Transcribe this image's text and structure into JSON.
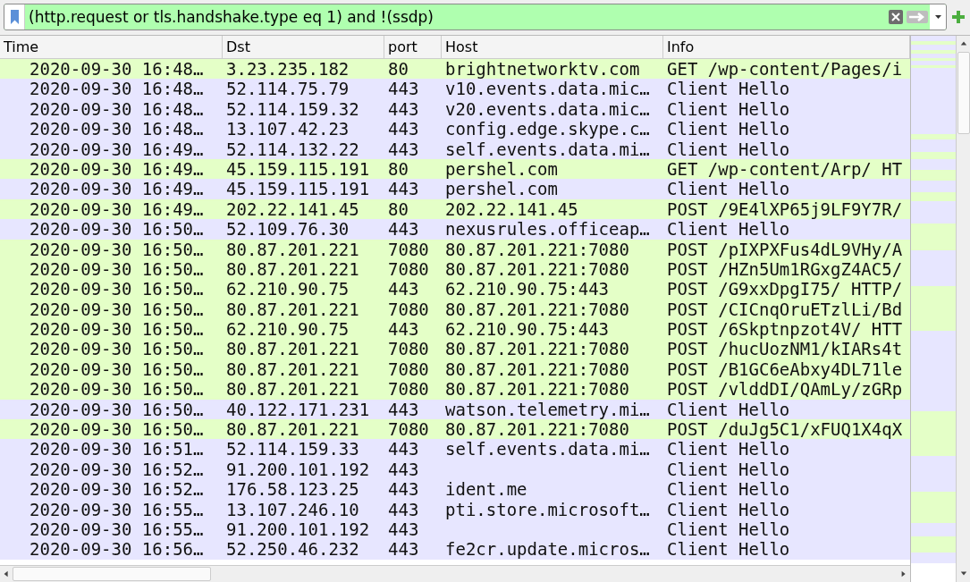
{
  "filter_bar": {
    "value": "(http.request or tls.handshake.type eq 1) and !(ssdp)",
    "valid": true
  },
  "table": {
    "columns": [
      "Time",
      "Dst",
      "port",
      "Host",
      "Info"
    ],
    "rows": [
      {
        "time": "2020-09-30 16:48…",
        "dst": "3.23.235.182",
        "port": "80",
        "host": "brightnetworktv.com",
        "info": "GET /wp-content/Pages/i",
        "color": "#e4ffc7"
      },
      {
        "time": "2020-09-30 16:48…",
        "dst": "52.114.75.79",
        "port": "443",
        "host": "v10.events.data.mic…",
        "info": "Client Hello",
        "color": "#e7e6ff"
      },
      {
        "time": "2020-09-30 16:48…",
        "dst": "52.114.159.32",
        "port": "443",
        "host": "v20.events.data.mic…",
        "info": "Client Hello",
        "color": "#e7e6ff"
      },
      {
        "time": "2020-09-30 16:48…",
        "dst": "13.107.42.23",
        "port": "443",
        "host": "config.edge.skype.c…",
        "info": "Client Hello",
        "color": "#e7e6ff"
      },
      {
        "time": "2020-09-30 16:49…",
        "dst": "52.114.132.22",
        "port": "443",
        "host": "self.events.data.mi…",
        "info": "Client Hello",
        "color": "#e7e6ff"
      },
      {
        "time": "2020-09-30 16:49…",
        "dst": "45.159.115.191",
        "port": "80",
        "host": "pershel.com",
        "info": "GET /wp-content/Arp/ HT",
        "color": "#e4ffc7"
      },
      {
        "time": "2020-09-30 16:49…",
        "dst": "45.159.115.191",
        "port": "443",
        "host": "pershel.com",
        "info": "Client Hello",
        "color": "#e7e6ff"
      },
      {
        "time": "2020-09-30 16:49…",
        "dst": "202.22.141.45",
        "port": "80",
        "host": "202.22.141.45",
        "info": "POST /9E4lXP65j9LF9Y7R/",
        "color": "#e4ffc7"
      },
      {
        "time": "2020-09-30 16:50…",
        "dst": "52.109.76.30",
        "port": "443",
        "host": "nexusrules.officeap…",
        "info": "Client Hello",
        "color": "#e7e6ff"
      },
      {
        "time": "2020-09-30 16:50…",
        "dst": "80.87.201.221",
        "port": "7080",
        "host": "80.87.201.221:7080",
        "info": "POST /pIXPXFus4dL9VHy/A",
        "color": "#e4ffc7"
      },
      {
        "time": "2020-09-30 16:50…",
        "dst": "80.87.201.221",
        "port": "7080",
        "host": "80.87.201.221:7080",
        "info": "POST /HZn5Um1RGxgZ4AC5/",
        "color": "#e4ffc7"
      },
      {
        "time": "2020-09-30 16:50…",
        "dst": "62.210.90.75",
        "port": "443",
        "host": "62.210.90.75:443",
        "info": "POST /G9xxDpgI75/ HTTP/",
        "color": "#e4ffc7"
      },
      {
        "time": "2020-09-30 16:50…",
        "dst": "80.87.201.221",
        "port": "7080",
        "host": "80.87.201.221:7080",
        "info": "POST /CICnqOruETzlLi/Bd",
        "color": "#e4ffc7"
      },
      {
        "time": "2020-09-30 16:50…",
        "dst": "62.210.90.75",
        "port": "443",
        "host": "62.210.90.75:443",
        "info": "POST /6Skptnpzot4V/ HTT",
        "color": "#e4ffc7"
      },
      {
        "time": "2020-09-30 16:50…",
        "dst": "80.87.201.221",
        "port": "7080",
        "host": "80.87.201.221:7080",
        "info": "POST /hucUozNM1/kIARs4t",
        "color": "#e4ffc7"
      },
      {
        "time": "2020-09-30 16:50…",
        "dst": "80.87.201.221",
        "port": "7080",
        "host": "80.87.201.221:7080",
        "info": "POST /B1GC6eAbxy4DL71le",
        "color": "#e4ffc7"
      },
      {
        "time": "2020-09-30 16:50…",
        "dst": "80.87.201.221",
        "port": "7080",
        "host": "80.87.201.221:7080",
        "info": "POST /vlddDI/QAmLy/zGRp",
        "color": "#e4ffc7"
      },
      {
        "time": "2020-09-30 16:50…",
        "dst": "40.122.171.231",
        "port": "443",
        "host": "watson.telemetry.mi…",
        "info": "Client Hello",
        "color": "#e7e6ff"
      },
      {
        "time": "2020-09-30 16:50…",
        "dst": "80.87.201.221",
        "port": "7080",
        "host": "80.87.201.221:7080",
        "info": "POST /duJg5C1/xFUQ1X4qX",
        "color": "#e4ffc7"
      },
      {
        "time": "2020-09-30 16:51…",
        "dst": "52.114.159.33",
        "port": "443",
        "host": "self.events.data.mi…",
        "info": "Client Hello",
        "color": "#e7e6ff"
      },
      {
        "time": "2020-09-30 16:52…",
        "dst": "91.200.101.192",
        "port": "443",
        "info": "Client Hello",
        "color": "#e7e6ff"
      },
      {
        "time": "2020-09-30 16:52…",
        "dst": "176.58.123.25",
        "port": "443",
        "host": "ident.me",
        "info": "Client Hello",
        "color": "#e7e6ff"
      },
      {
        "time": "2020-09-30 16:55…",
        "dst": "13.107.246.10",
        "port": "443",
        "host": "pti.store.microsoft…",
        "info": "Client Hello",
        "color": "#e7e6ff"
      },
      {
        "time": "2020-09-30 16:55…",
        "dst": "91.200.101.192",
        "port": "443",
        "info": "Client Hello",
        "color": "#e7e6ff"
      },
      {
        "time": "2020-09-30 16:56…",
        "dst": "52.250.46.232",
        "port": "443",
        "host": "fe2cr.update.micros…",
        "info": "Client Hello",
        "color": "#e7e6ff"
      }
    ]
  }
}
